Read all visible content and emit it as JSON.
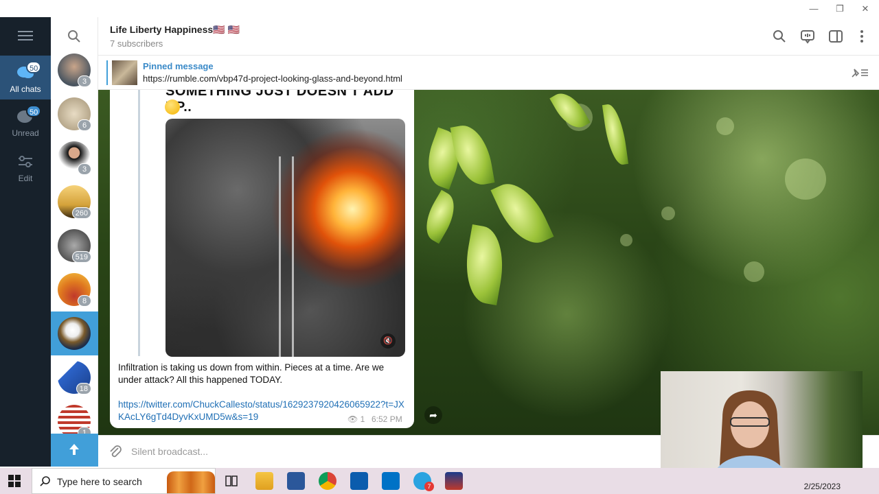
{
  "window": {
    "minimize": "—",
    "restore": "❐",
    "close": "✕"
  },
  "folders": {
    "items": [
      {
        "label": "All chats",
        "badge": "50",
        "active": true
      },
      {
        "label": "Unread",
        "badge": "50",
        "active": false
      },
      {
        "label": "Edit"
      }
    ]
  },
  "chats": {
    "items": [
      {
        "badge": "3",
        "color": "#4a5560"
      },
      {
        "badge": "6",
        "color": "#b7a88c"
      },
      {
        "badge": "3",
        "color": "#f1f1f1"
      },
      {
        "badge": "260",
        "color": "#d4a23a"
      },
      {
        "badge": "519",
        "color": "#6a6a6a"
      },
      {
        "badge": "8",
        "color": "#e07a1f"
      },
      {
        "badge": "",
        "color": "#1e2e4a",
        "active": true
      },
      {
        "badge": "18",
        "color": "#2c63c9"
      },
      {
        "badge": "1",
        "color": "#233a7a"
      }
    ]
  },
  "header": {
    "title": "Life Liberty Happiness🇺🇸 🇺🇸",
    "subtitle": "7 subscribers"
  },
  "pinned": {
    "title": "Pinned message",
    "text": "https://rumble.com/vbp47d-project-looking-glass-and-beyond.html"
  },
  "message": {
    "cut_heading": "SOMETHING JUST DOESN'T ADD UP..",
    "text": "Infiltration is taking us down from within. Pieces at a time. Are we under attack? All this happened TODAY.",
    "link": "https://twitter.com/ChuckCallesto/status/1629237920426065922?t=JXKAcLY6gTd4DyvKxUMD5w&s=19",
    "views": "1",
    "time": "6:52 PM"
  },
  "composer": {
    "placeholder": "Silent broadcast..."
  },
  "taskbar": {
    "search_placeholder": "Type here to search",
    "telegram_badge": "7",
    "date": "2/25/2023"
  },
  "colors": {
    "accent": "#419fd9",
    "folders_bg": "#17212b"
  }
}
